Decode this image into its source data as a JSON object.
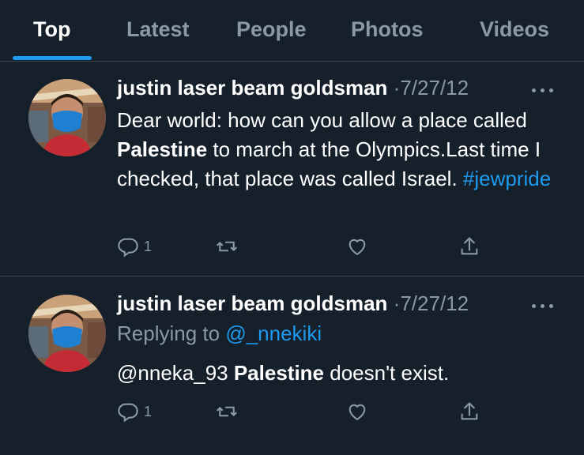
{
  "tabs": [
    {
      "label": "Top",
      "active": true
    },
    {
      "label": "Latest",
      "active": false
    },
    {
      "label": "People",
      "active": false
    },
    {
      "label": "Photos",
      "active": false
    },
    {
      "label": "Videos",
      "active": false
    }
  ],
  "colors": {
    "background": "#15202b",
    "text": "#ffffff",
    "muted": "#8b98a5",
    "accent": "#1d9bf0",
    "divider": "#38444d"
  },
  "tweets": [
    {
      "author": "justin laser beam goldsman",
      "separator": "·",
      "date": "7/27/12",
      "text_parts": [
        "Dear world: how can you allow a place called ",
        "Palestine",
        " to march at the Olympics.Last time I checked, that place was called Israel. ",
        "#jewpride"
      ],
      "reply_count": "1",
      "icons": [
        "reply-icon",
        "retweet-icon",
        "like-icon",
        "share-icon"
      ]
    },
    {
      "author": "justin laser beam goldsman",
      "separator": "·",
      "date": "7/27/12",
      "replying_prefix": "Replying to ",
      "replying_to": "@_nnekiki",
      "text_parts": [
        "@nneka_93 ",
        "Palestine",
        " doesn't exist."
      ],
      "reply_count": "1",
      "icons": [
        "reply-icon",
        "retweet-icon",
        "like-icon",
        "share-icon"
      ]
    }
  ]
}
